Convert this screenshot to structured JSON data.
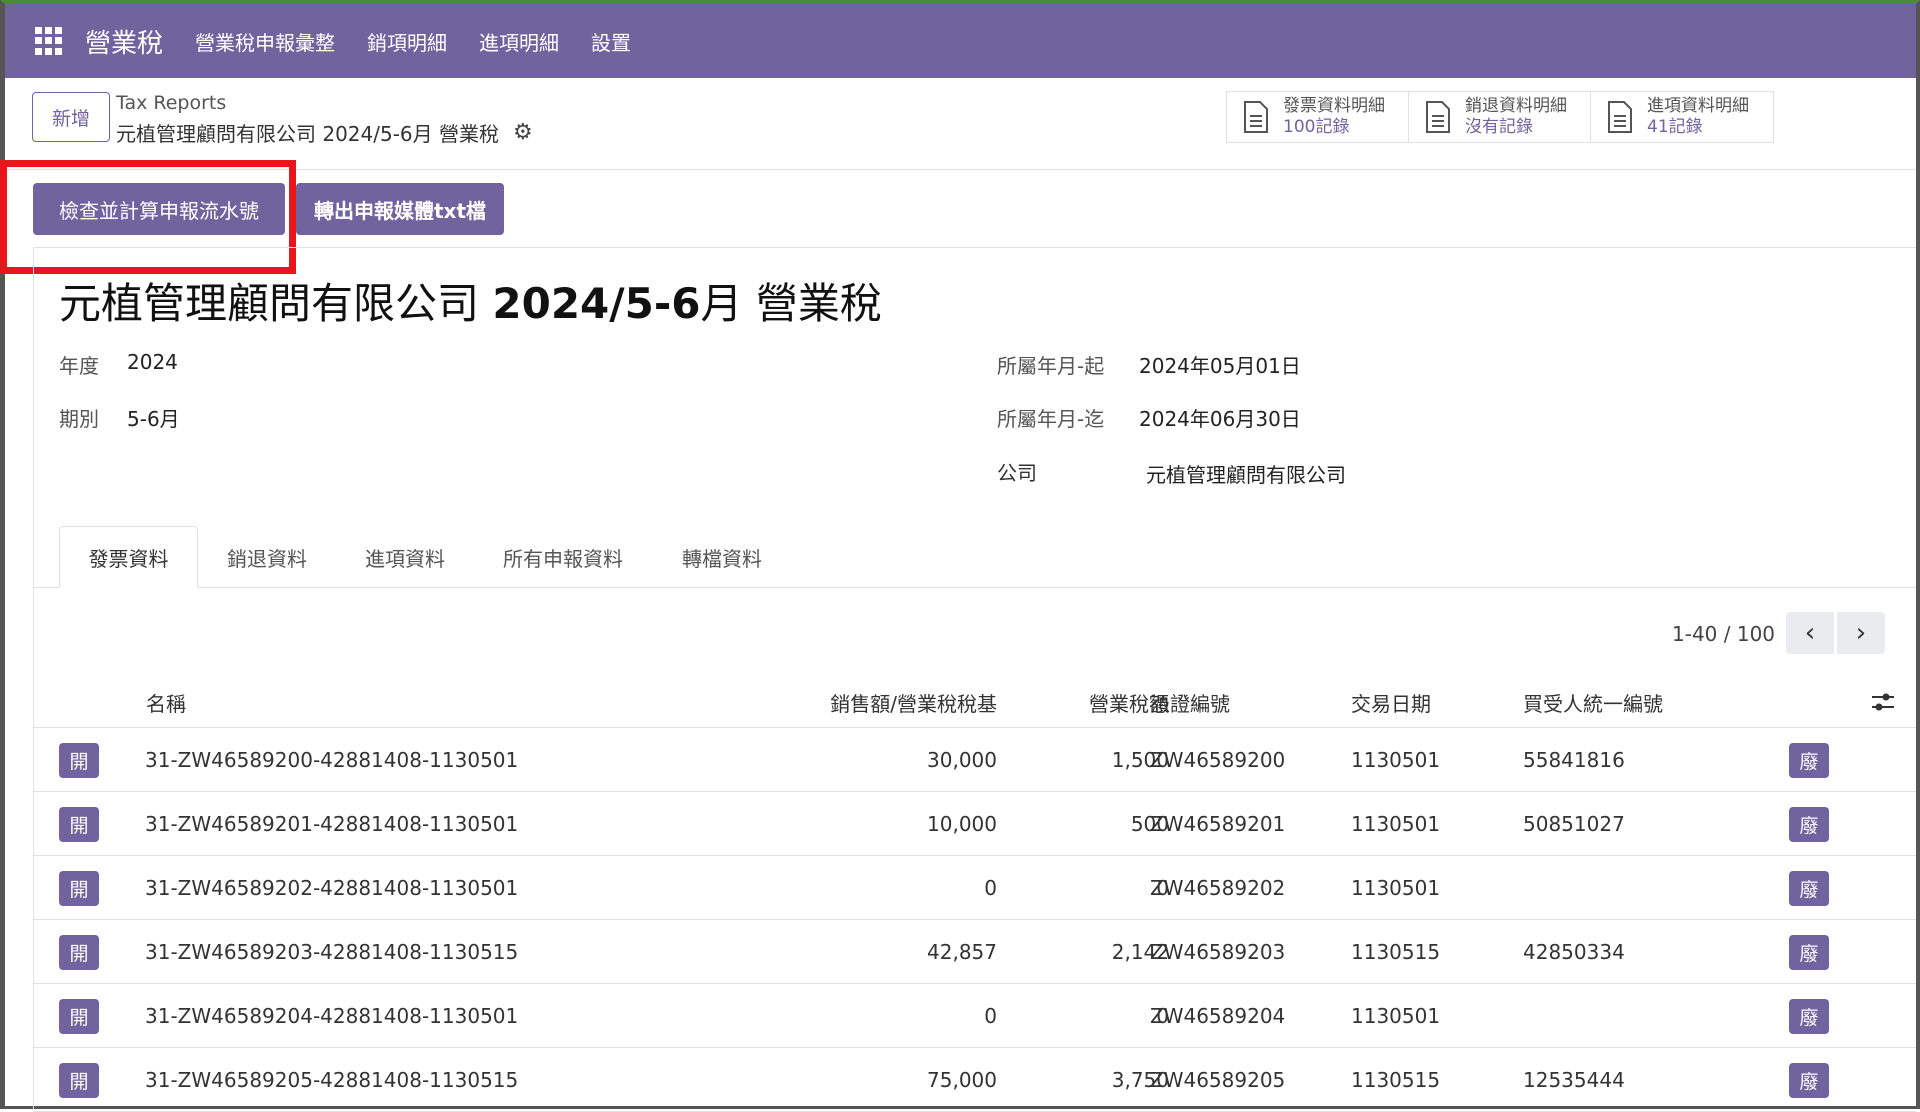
{
  "nav": {
    "brand": "營業稅",
    "menu": [
      "營業稅申報彙整",
      "銷項明細",
      "進項明細",
      "設置"
    ]
  },
  "control": {
    "new_label": "新增",
    "breadcrumb_parent": "Tax Reports",
    "breadcrumb_current": "元植管理顧問有限公司 2024/5-6月 營業稅",
    "stats": [
      {
        "label": "發票資料明細",
        "value": "100記錄"
      },
      {
        "label": "銷退資料明細",
        "value": "沒有記錄"
      },
      {
        "label": "進項資料明細",
        "value": "41記錄"
      }
    ]
  },
  "actions": {
    "check_label": "檢查並計算申報流水號",
    "export_label": "轉出申報媒體txt檔"
  },
  "form": {
    "title_prefix": "元植管理顧問有限公司",
    "title_bold": "2024/5-6",
    "title_suffix": "月 營業稅",
    "year_label": "年度",
    "year_value": "2024",
    "period_label": "期別",
    "period_value": "5-6月",
    "start_label": "所屬年月-起",
    "start_value": "2024年05月01日",
    "end_label": "所屬年月-迄",
    "end_value": "2024年06月30日",
    "company_label": "公司",
    "company_value": "元植管理顧問有限公司"
  },
  "tabs": [
    "發票資料",
    "銷退資料",
    "進項資料",
    "所有申報資料",
    "轉檔資料"
  ],
  "pager": {
    "text": "1-40 / 100"
  },
  "table": {
    "headers": {
      "name": "名稱",
      "sales": "銷售額/營業稅稅基",
      "tax": "營業稅額",
      "voucher": "憑證編號",
      "date": "交易日期",
      "buyer": "買受人統一編號"
    },
    "open_label": "開",
    "void_label": "廢",
    "rows": [
      {
        "name": "31-ZW46589200-42881408-1130501",
        "sales": "30,000",
        "tax": "1,500",
        "voucher": "ZW46589200",
        "date": "1130501",
        "buyer": "55841816"
      },
      {
        "name": "31-ZW46589201-42881408-1130501",
        "sales": "10,000",
        "tax": "500",
        "voucher": "ZW46589201",
        "date": "1130501",
        "buyer": "50851027"
      },
      {
        "name": "31-ZW46589202-42881408-1130501",
        "sales": "0",
        "tax": "0",
        "voucher": "ZW46589202",
        "date": "1130501",
        "buyer": ""
      },
      {
        "name": "31-ZW46589203-42881408-1130515",
        "sales": "42,857",
        "tax": "2,142",
        "voucher": "ZW46589203",
        "date": "1130515",
        "buyer": "42850334"
      },
      {
        "name": "31-ZW46589204-42881408-1130501",
        "sales": "0",
        "tax": "0",
        "voucher": "ZW46589204",
        "date": "1130501",
        "buyer": ""
      },
      {
        "name": "31-ZW46589205-42881408-1130515",
        "sales": "75,000",
        "tax": "3,750",
        "voucher": "ZW46589205",
        "date": "1130515",
        "buyer": "12535444"
      }
    ]
  },
  "colors": {
    "brand": "#71639e",
    "highlight": "#e8161b"
  }
}
